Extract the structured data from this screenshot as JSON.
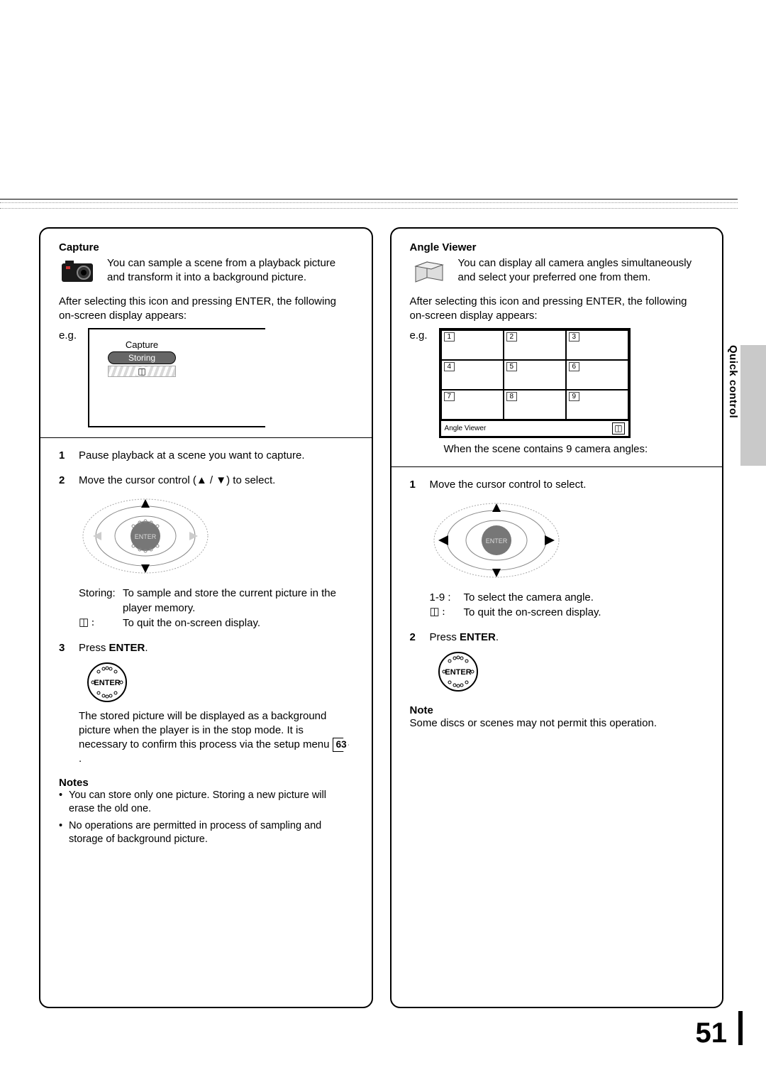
{
  "sidebar": {
    "tab_label": "Quick control"
  },
  "page_number": "51",
  "left": {
    "title": "Capture",
    "intro": "You can sample a scene from a playback picture and transform it into a background picture.",
    "after": "After selecting this icon and pressing ENTER, the following on-screen display appears:",
    "eg": "e.g.",
    "dialog": {
      "title": "Capture",
      "status": "Storing",
      "return_glyph": "◫"
    },
    "steps": {
      "s1": "Pause playback at a scene you want to capture.",
      "s2_pre": "Move the cursor control (",
      "s2_arrows": "▲ / ▼",
      "s2_post": ") to select.",
      "def_storing_k": "Storing:",
      "def_storing_v": "To sample and store the current picture in the player memory.",
      "def_quit_k": "◫ :",
      "def_quit_v": "To quit the on-screen display.",
      "s3_pre": "Press ",
      "s3_btn": "ENTER",
      "s3_post": ".",
      "s3_para_a": "The stored picture will be displayed as a background picture when the player is in the stop mode. It is necessary to confirm this process via the setup menu ",
      "s3_ref": "63",
      "s3_para_b": "."
    },
    "notes_hdr": "Notes",
    "notes": [
      "You can store only one picture. Storing a new picture will erase the old one.",
      "No operations are permitted in process of sampling and storage of background picture."
    ]
  },
  "right": {
    "title": "Angle Viewer",
    "intro": "You can display all camera angles simultaneously and select your preferred one from them.",
    "after": "After selecting this icon and pressing ENTER, the following on-screen display appears:",
    "eg": "e.g.",
    "grid_labels": [
      "1",
      "2",
      "3",
      "4",
      "5",
      "6",
      "7",
      "8",
      "9"
    ],
    "grid_footer": "Angle Viewer",
    "grid_return": "◫",
    "caption": "When the scene contains 9 camera angles:",
    "steps": {
      "s1": "Move the cursor control to select.",
      "def_range_k": "1-9 :",
      "def_range_v": "To select the camera angle.",
      "def_quit_k": "◫ :",
      "def_quit_v": "To quit the on-screen display.",
      "s2_pre": "Press ",
      "s2_btn": "ENTER",
      "s2_post": "."
    },
    "note_hdr": "Note",
    "note": "Some discs or scenes may not permit this operation."
  },
  "svg_labels": {
    "enter": "ENTER"
  }
}
